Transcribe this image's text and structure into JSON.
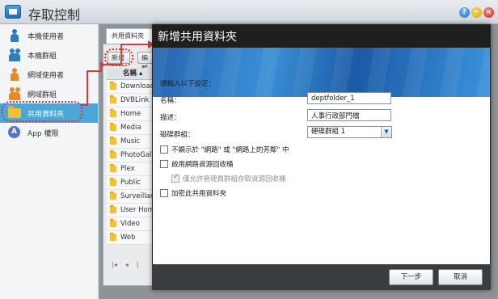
{
  "app": {
    "title": "存取控制"
  },
  "sidebar": {
    "items": [
      {
        "label": "本機使用者"
      },
      {
        "label": "本機群組"
      },
      {
        "label": "網域使用者"
      },
      {
        "label": "網域群組"
      },
      {
        "label": "共用資料夾"
      },
      {
        "label": "App 權限"
      }
    ]
  },
  "content": {
    "tab_label": "共用資料夾",
    "new_button": "新增",
    "other_button": "編輯",
    "column_header": "名稱 ▴",
    "folders": [
      "Download",
      "DVBLink",
      "Home",
      "Media",
      "Music",
      "PhotoGallery",
      "Plex",
      "Public",
      "Surveillance",
      "User Home",
      "Video",
      "Web"
    ],
    "pager": {
      "first": "|◂",
      "prev": "◂",
      "sep": "|"
    }
  },
  "modal": {
    "title": "新增共用資料夾",
    "intro": "請輸入以下設定：",
    "name_label": "名稱：",
    "name_value": "deptfolder_1",
    "desc_label": "描述：",
    "desc_value": "人事行政部門檔",
    "volume_label": "磁碟群組：",
    "volume_value": "硬碟群組 1",
    "opt_hide": "不顯示於 \"網路\" 或 \"網路上的芳鄰\" 中",
    "opt_recycle": "啟用網路資源回收桶",
    "opt_admin_only": "僅允許管理員群組存取資源回收桶",
    "opt_encrypt": "加密此共用資料夾",
    "next_button": "下一步",
    "cancel_button": "取消"
  },
  "colors": {
    "accent": "#4aa7d8",
    "header": "#1f1f1f",
    "annotation": "#d43b3b"
  },
  "icons": {
    "local_user": "person-icon",
    "local_group": "group-icon",
    "domain_user": "person-icon",
    "domain_group": "group-icon",
    "shared_folder": "folder-icon",
    "app_permission": "app-icon"
  }
}
